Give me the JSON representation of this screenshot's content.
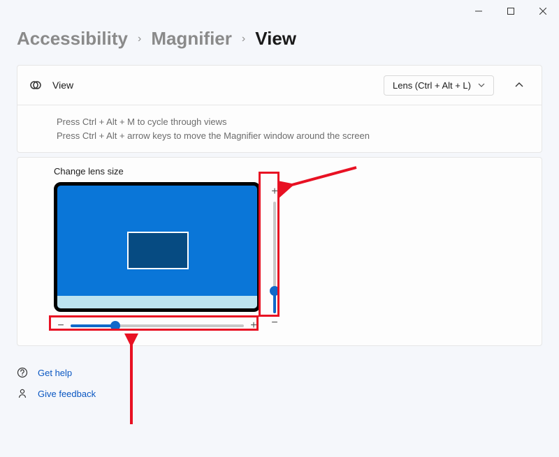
{
  "window_controls": {
    "minimize": "minimize",
    "maximize": "maximize",
    "close": "close"
  },
  "breadcrumb": {
    "items": [
      "Accessibility",
      "Magnifier",
      "View"
    ],
    "current_index": 2
  },
  "view_card": {
    "title": "View",
    "selected_option": "Lens (Ctrl + Alt + L)",
    "expanded": true,
    "tips": [
      "Press Ctrl + Alt + M to cycle through views",
      "Press Ctrl + Alt + arrow keys to move the Magnifier window around the screen"
    ]
  },
  "lens_card": {
    "title": "Change lens size",
    "vertical_slider": {
      "value": 20,
      "min": 0,
      "max": 100
    },
    "horizontal_slider": {
      "value": 26,
      "min": 0,
      "max": 100
    },
    "plus_label": "+",
    "minus_label": "−"
  },
  "footer": {
    "help": "Get help",
    "feedback": "Give feedback"
  },
  "colors": {
    "accent": "#1068c9",
    "annotation": "#e81123",
    "screen": "#0a76d8"
  }
}
